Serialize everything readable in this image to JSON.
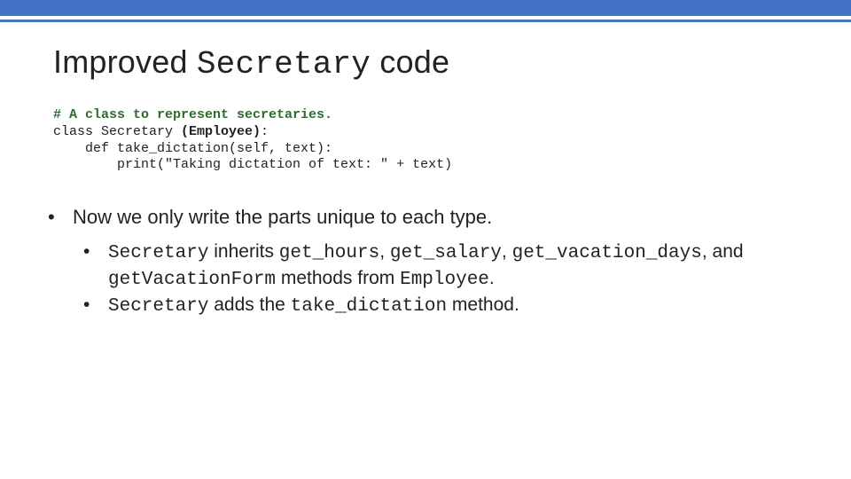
{
  "title": {
    "part1": "Improved ",
    "part2": "Secretary",
    "part3": " code"
  },
  "code": {
    "comment": "# A class to represent secretaries.",
    "line2a": "class Secretary ",
    "line2b": "(Employee)",
    "line2c": ":",
    "line3": "    def take_dictation(self, text):",
    "line4": "        print(\"Taking dictation of text: \" + text)"
  },
  "bullets": {
    "b1": "Now we only write the parts unique to each type.",
    "b2": {
      "c1": "Secretary",
      "t1": " inherits ",
      "c2": "get_hours",
      "t2": ", ",
      "c3": "get_salary",
      "t3": ", ",
      "c4": "get_vacation_days",
      "t4": ", and ",
      "c5": "getVacationForm",
      "t5": " methods from ",
      "c6": "Employee",
      "t6": "."
    },
    "b3": {
      "c1": "Secretary",
      "t1": " adds the ",
      "c2": "take_dictation",
      "t2": " method."
    }
  },
  "colors": {
    "band": "#4472c4",
    "comment": "#2e6b2e"
  }
}
